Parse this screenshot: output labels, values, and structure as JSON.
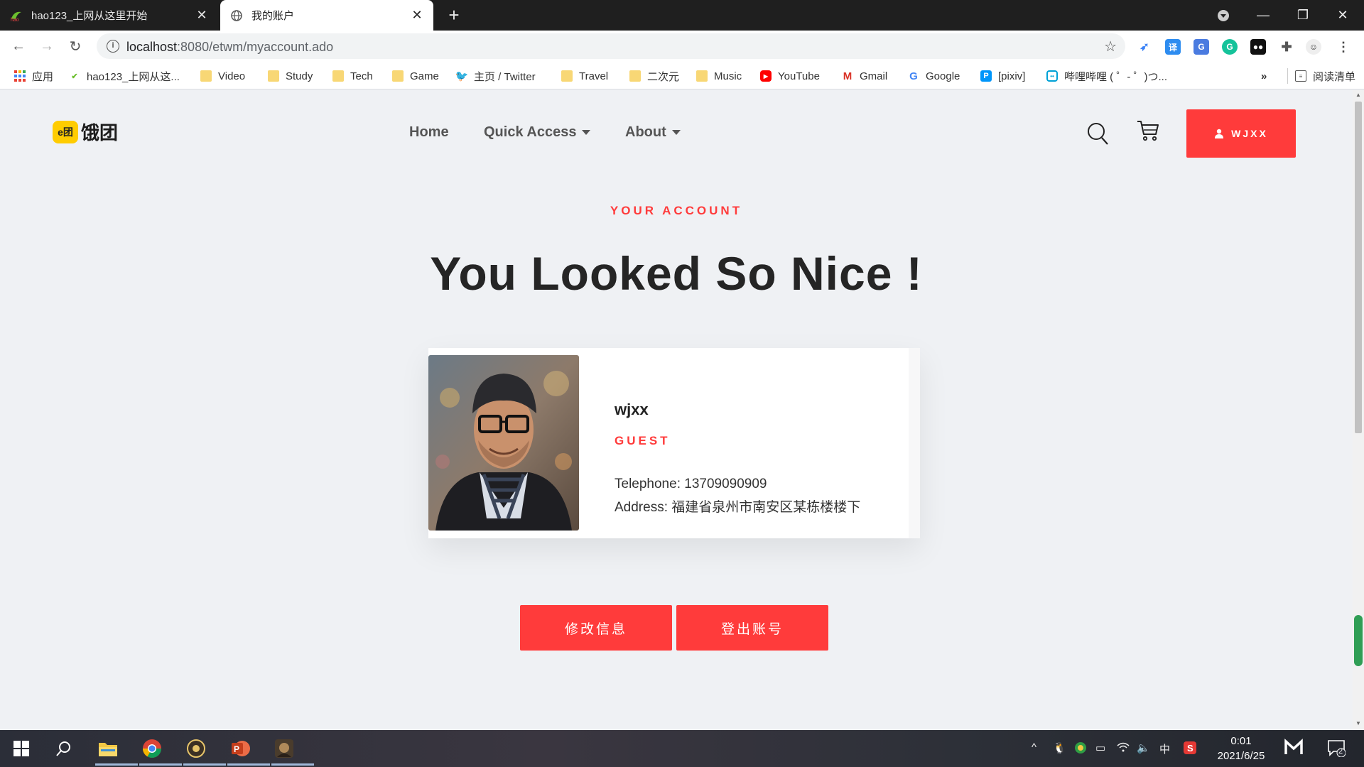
{
  "browser": {
    "tabs": [
      {
        "title": "hao123_上网从这里开始",
        "active": false
      },
      {
        "title": "我的账户",
        "active": true
      }
    ],
    "address": {
      "host": "localhost",
      "path": ":8080/etwm/myaccount.ado"
    },
    "bookmarks": [
      {
        "label": "应用",
        "icon": "apps-grid-icon"
      },
      {
        "label": "hao123_上网从这...",
        "icon": "hao123-icon"
      },
      {
        "label": "Video",
        "icon": "folder-icon"
      },
      {
        "label": "Study",
        "icon": "folder-icon"
      },
      {
        "label": "Tech",
        "icon": "folder-icon"
      },
      {
        "label": "Game",
        "icon": "folder-icon"
      },
      {
        "label": "主页 / Twitter",
        "icon": "twitter-icon"
      },
      {
        "label": "Travel",
        "icon": "folder-icon"
      },
      {
        "label": "二次元",
        "icon": "folder-icon"
      },
      {
        "label": "Music",
        "icon": "folder-icon"
      },
      {
        "label": "YouTube",
        "icon": "youtube-icon"
      },
      {
        "label": "Gmail",
        "icon": "gmail-icon"
      },
      {
        "label": "Google",
        "icon": "google-icon"
      },
      {
        "label": "[pixiv]",
        "icon": "pixiv-icon"
      },
      {
        "label": "哔哩哔哩 ( ゜- ゜)つ...",
        "icon": "bilibili-icon"
      }
    ],
    "bookmarks_overflow": "»",
    "reading_list": "阅读清单"
  },
  "site": {
    "logo_mark": "e团",
    "logo_text": "饿团",
    "nav": {
      "home": "Home",
      "quick_access": "Quick Access",
      "about": "About"
    },
    "user_button": "WJXX"
  },
  "account": {
    "eyebrow": "YOUR ACCOUNT",
    "headline": "You Looked So Nice !",
    "username": "wjxx",
    "role": "GUEST",
    "telephone": "Telephone: 13709090909",
    "address": "Address: 福建省泉州市南安区某栋楼楼下",
    "edit_button": "修改信息",
    "logout_button": "登出账号"
  },
  "taskbar": {
    "ime": "中",
    "time": "0:01",
    "date": "2021/6/25",
    "notifications": "2"
  },
  "colors": {
    "accent": "#ff3b3b",
    "page_bg": "#eff1f4",
    "heading": "#252525"
  }
}
